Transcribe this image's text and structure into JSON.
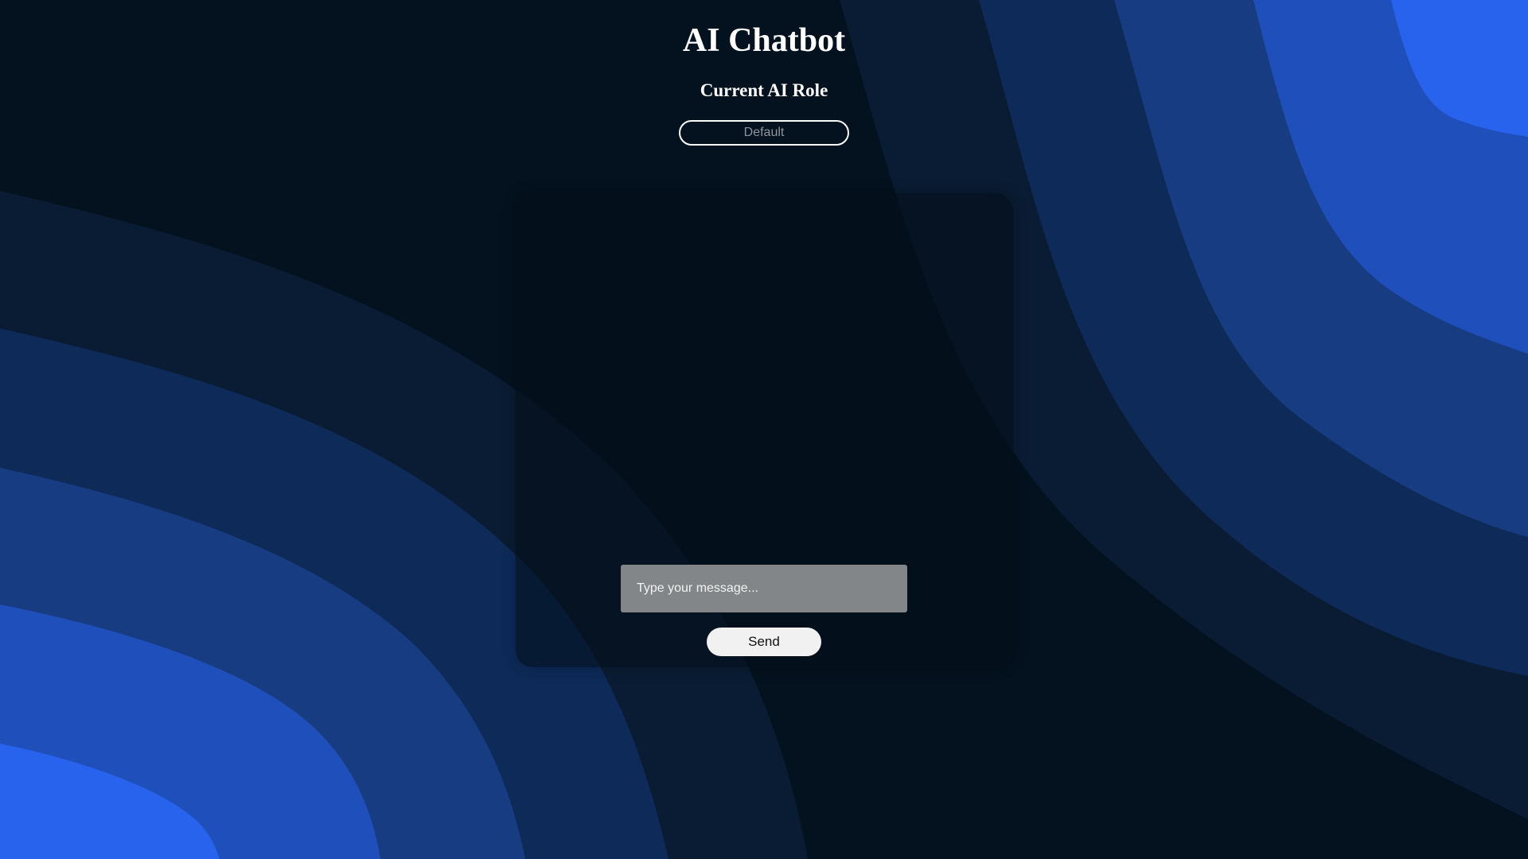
{
  "app": {
    "title": "AI Chatbot"
  },
  "role": {
    "heading": "Current AI Role",
    "selected": "Default"
  },
  "chat": {
    "input_placeholder": "Type your message...",
    "input_value": "",
    "send_label": "Send"
  },
  "colors": {
    "background_dark": "#04121f",
    "wave_blue_1": "#0a1c33",
    "wave_blue_2": "#0d2a58",
    "wave_blue_3": "#173c82",
    "wave_blue_4": "#1f4fba",
    "wave_blue_5": "#2863ee",
    "input_background": "#828689",
    "button_background": "#f1f1f1"
  }
}
